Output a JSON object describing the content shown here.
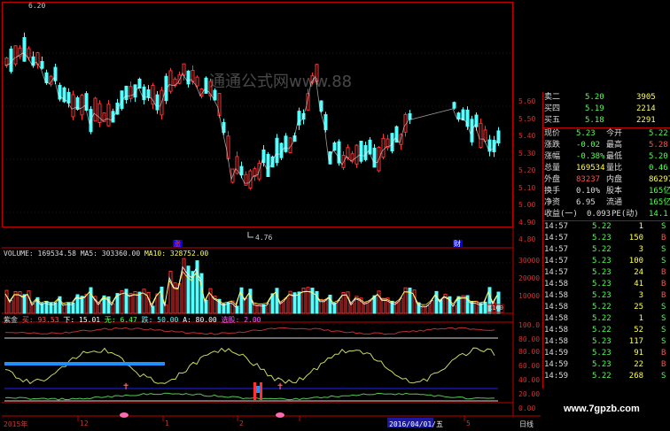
{
  "chart": {
    "top_price": "6.20",
    "low_marker": "4.76",
    "price_ticks": [
      "5.60",
      "5.50",
      "5.40",
      "5.30",
      "5.20",
      "5.10",
      "5.00",
      "4.90",
      "4.80"
    ],
    "event_tags": [
      "涨",
      "财"
    ],
    "volume_header": {
      "vol": "VOLUME: 169534.58",
      "ma5": "MA5: 303360.00",
      "ma10": "MA10: 328752.00"
    },
    "volume_ticks": [
      "30000",
      "20000",
      "10000"
    ],
    "volume_unit": "X100",
    "indicator_header": {
      "name": "紫金",
      "a": "买: 93.53",
      "b": "下: 15.01",
      "c": "无: 6.47",
      "d": "跌: 50.00",
      "e": "A: 80.00",
      "f": "选股: 2.00"
    },
    "indicator_ticks": [
      "100.0",
      "80.00",
      "60.00",
      "40.00",
      "20.00",
      "0.00"
    ],
    "osc_ticks": [
      "100.0",
      "80.00",
      "60.00",
      "40.00",
      "20.00",
      "0.00"
    ],
    "date_axis": [
      "2015年",
      "12",
      "1",
      "2",
      "3",
      "2016/04/01/五",
      "5"
    ],
    "period_label": "日线",
    "colors": {
      "up": "#ff3232",
      "down": "#54ffff",
      "ma": "#ffff54",
      "axis": "#c00000",
      "blue_line": "#1e90ff"
    }
  },
  "quotes": {
    "rows": [
      {
        "label": "卖二",
        "value": "5.20",
        "extra": "3905"
      },
      {
        "label": "买四",
        "value": "5.19",
        "extra": "2214"
      },
      {
        "label": "买五",
        "value": "5.18",
        "extra": "2291"
      }
    ],
    "stats": [
      {
        "l1": "现价",
        "v1": "5.23",
        "l2": "今开",
        "v2": "5.22"
      },
      {
        "l1": "涨跌",
        "v1": "-0.02",
        "l2": "最高",
        "v2": "5.28"
      },
      {
        "l1": "涨幅",
        "v1": "-0.38%",
        "l2": "最低",
        "v2": "5.20"
      },
      {
        "l1": "总量",
        "v1": "169534",
        "l2": "量比",
        "v2": "0.46"
      },
      {
        "l1": "外盘",
        "v1": "83237",
        "l2": "内盘",
        "v2": "86297"
      },
      {
        "l1": "换手",
        "v1": "0.10%",
        "l2": "股本",
        "v2": "165亿"
      },
      {
        "l1": "净资",
        "v1": "6.95",
        "l2": "流通",
        "v2": "165亿"
      },
      {
        "l1": "收益(一)",
        "v1": "0.093",
        "l2": "PE(动)",
        "v2": "14.1"
      }
    ],
    "ticks": [
      {
        "time": "14:57",
        "price": "5.22",
        "vol": "1",
        "bs": "S"
      },
      {
        "time": "14:57",
        "price": "5.23",
        "vol": "150",
        "bs": "B"
      },
      {
        "time": "14:57",
        "price": "5.22",
        "vol": "3",
        "bs": "S"
      },
      {
        "time": "14:57",
        "price": "5.23",
        "vol": "100",
        "bs": "S"
      },
      {
        "time": "14:57",
        "price": "5.23",
        "vol": "24",
        "bs": "B"
      },
      {
        "time": "14:58",
        "price": "5.23",
        "vol": "41",
        "bs": "B"
      },
      {
        "time": "14:58",
        "price": "5.23",
        "vol": "3",
        "bs": "B"
      },
      {
        "time": "14:58",
        "price": "5.22",
        "vol": "25",
        "bs": "S"
      },
      {
        "time": "14:58",
        "price": "5.22",
        "vol": "1",
        "bs": "S"
      },
      {
        "time": "14:58",
        "price": "5.22",
        "vol": "52",
        "bs": "S"
      },
      {
        "time": "14:58",
        "price": "5.23",
        "vol": "117",
        "bs": "S"
      },
      {
        "time": "14:59",
        "price": "5.23",
        "vol": "91",
        "bs": "B"
      },
      {
        "time": "14:59",
        "price": "5.23",
        "vol": "22",
        "bs": "B"
      },
      {
        "time": "14:59",
        "price": "5.22",
        "vol": "268",
        "bs": "S"
      }
    ]
  },
  "watermark": "通通公式网www.88",
  "site": "www.7gpzb.com"
}
